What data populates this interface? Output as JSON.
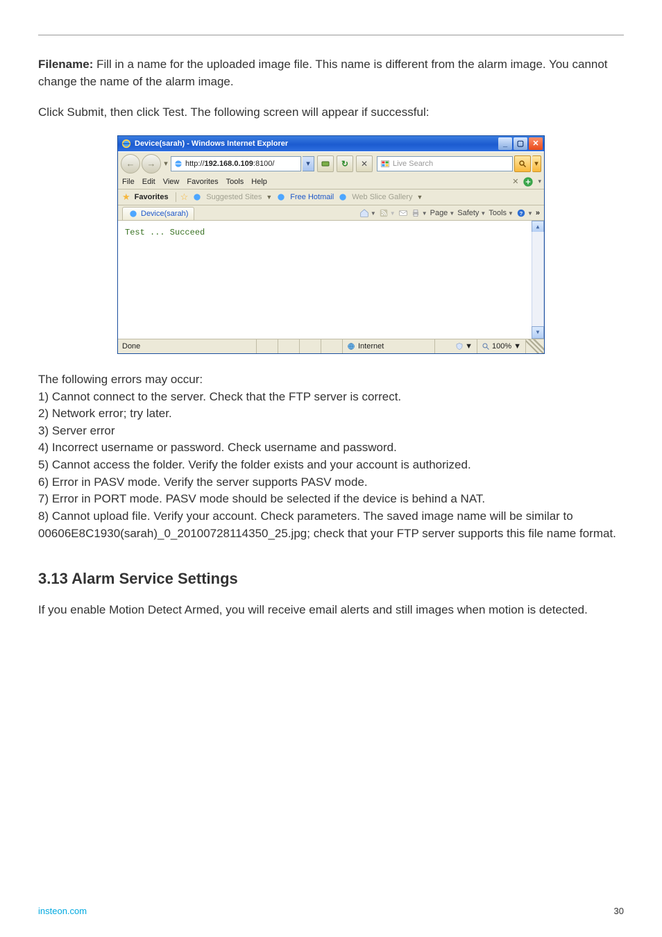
{
  "doc": {
    "para1": {
      "label": "Filename:",
      "text": " Fill in a name for the uploaded image file. This name is different from the alarm image. You cannot change the name of the alarm image."
    },
    "para2": "Click Submit, then click Test. The following screen will appear if successful:",
    "errors_intro": "The following errors may occur:",
    "errors": [
      "1) Cannot connect to the server. Check that the FTP server is correct.",
      "2) Network error; try later.",
      "3) Server error",
      "4) Incorrect username or password. Check username and password.",
      "5) Cannot access the folder. Verify the folder exists and your account is authorized.",
      "6) Error in PASV mode. Verify the server supports PASV mode.",
      "7) Error in PORT mode. PASV mode should be selected if the device is behind a NAT.",
      "8) Cannot upload file. Verify your account. Check parameters. The saved image name will be similar to 00606E8C1930(sarah)_0_20100728114350_25.jpg; check that your FTP server supports this file name format."
    ],
    "section_heading": "3.13 Alarm Service Settings",
    "para3": "If you enable Motion Detect Armed, you will receive email alerts and still images when motion is detected.",
    "footer_site": "insteon.com",
    "footer_page": "30"
  },
  "ie": {
    "title": "Device(sarah) - Windows Internet Explorer",
    "url": "http://192.168.0.109:8100/",
    "url_bold": "192.168.0.109",
    "search_placeholder": "Live Search",
    "menus": [
      "File",
      "Edit",
      "View",
      "Favorites",
      "Tools",
      "Help"
    ],
    "fav_label": "Favorites",
    "suggested_sites": "Suggested Sites",
    "free_hotmail": "Free Hotmail",
    "web_slice": "Web Slice Gallery",
    "tab_label": "Device(sarah)",
    "cmd_page": "Page",
    "cmd_safety": "Safety",
    "cmd_tools": "Tools",
    "content_text": "Test ... Succeed",
    "status_done": "Done",
    "status_zone": "Internet",
    "zoom": "100%"
  }
}
